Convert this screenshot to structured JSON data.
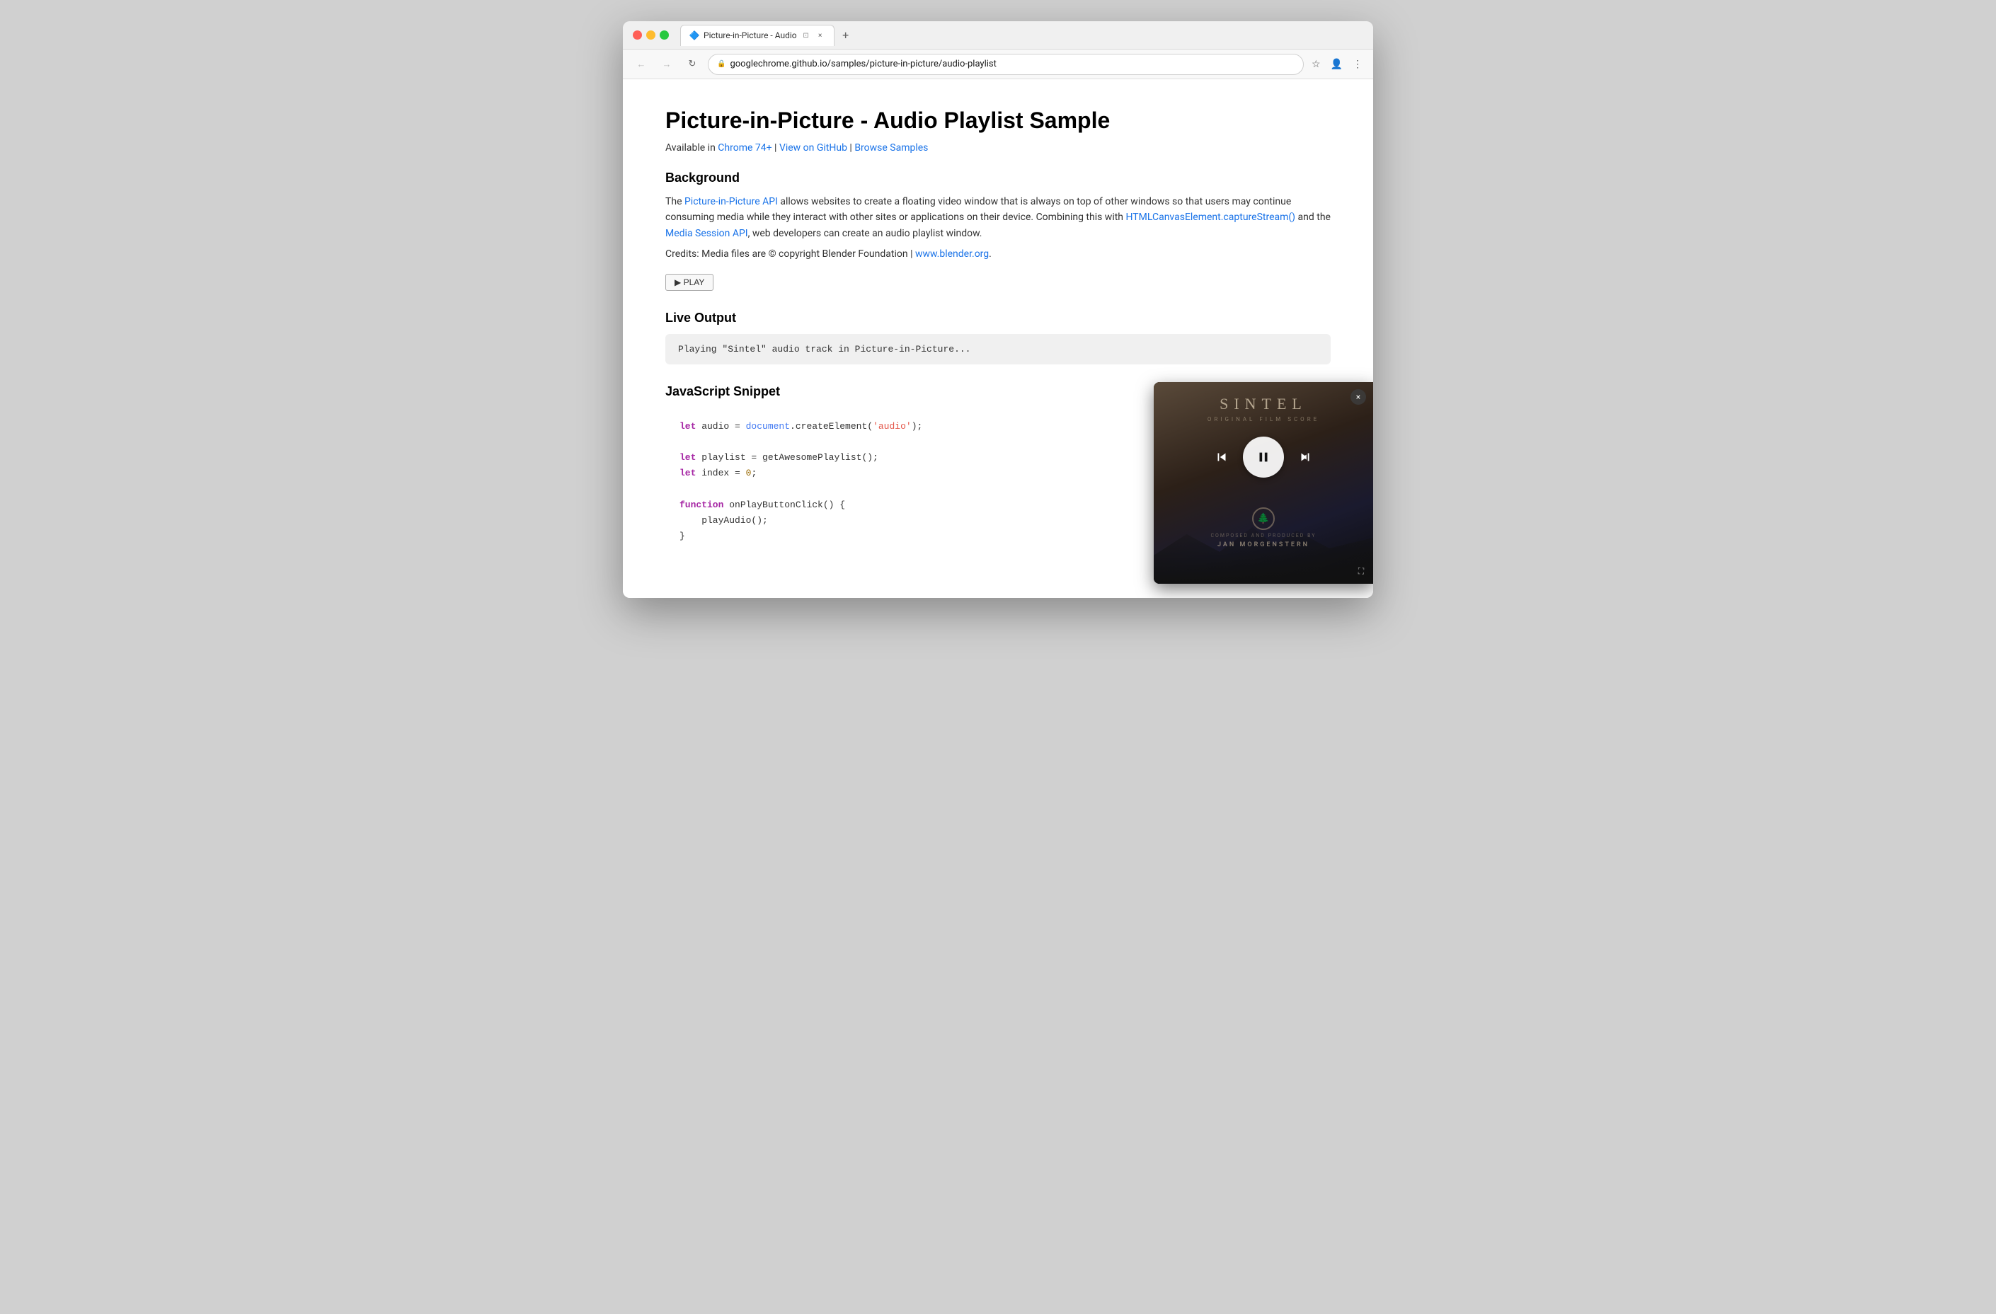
{
  "browser": {
    "tab_title": "Picture-in-Picture - Audio",
    "tab_favicon": "🔷",
    "url": "googlechrome.github.io/samples/picture-in-picture/audio-playlist",
    "new_tab_label": "+"
  },
  "page": {
    "title": "Picture-in-Picture - Audio Playlist Sample",
    "availability_prefix": "Available in ",
    "availability_chrome": "Chrome 74+",
    "availability_sep1": " | ",
    "availability_github": "View on GitHub",
    "availability_sep2": " | ",
    "availability_samples": "Browse Samples",
    "background_heading": "Background",
    "background_text1_before": "The ",
    "background_link1": "Picture-in-Picture API",
    "background_text1_after": " allows websites to create a floating video window that is always on top of other windows so that users may continue consuming media while they interact with other sites or applications on their device. Combining this with ",
    "background_link2": "HTMLCanvasElement.captureStream()",
    "background_text2_mid": " and the ",
    "background_link3": "Media Session API",
    "background_text2_end": ", web developers can create an audio playlist window.",
    "credits": "Credits: Media files are © copyright Blender Foundation | ",
    "credits_link": "www.blender.org",
    "credits_end": ".",
    "play_button_label": "▶ PLAY",
    "live_output_heading": "Live Output",
    "live_output_text": "Playing \"Sintel\" audio track in Picture-in-Picture...",
    "js_snippet_heading": "JavaScript Snippet",
    "code_line1": "let audio = document.createElement('audio');",
    "code_line2": "let playlist = getAwesomePlaylist();",
    "code_line3": "let index = 0;",
    "code_line4": "function onPlayButtonClick() {",
    "code_line5": "    playAudio();",
    "code_line6": "}"
  },
  "pip": {
    "title": "SINTEL",
    "subtitle": "ORIGINAL FILM SCORE",
    "close_label": "×",
    "composer_label": "Composed and Produced by",
    "composer_name": "JAN MORGENSTERN",
    "expand_icon": "⛶"
  }
}
